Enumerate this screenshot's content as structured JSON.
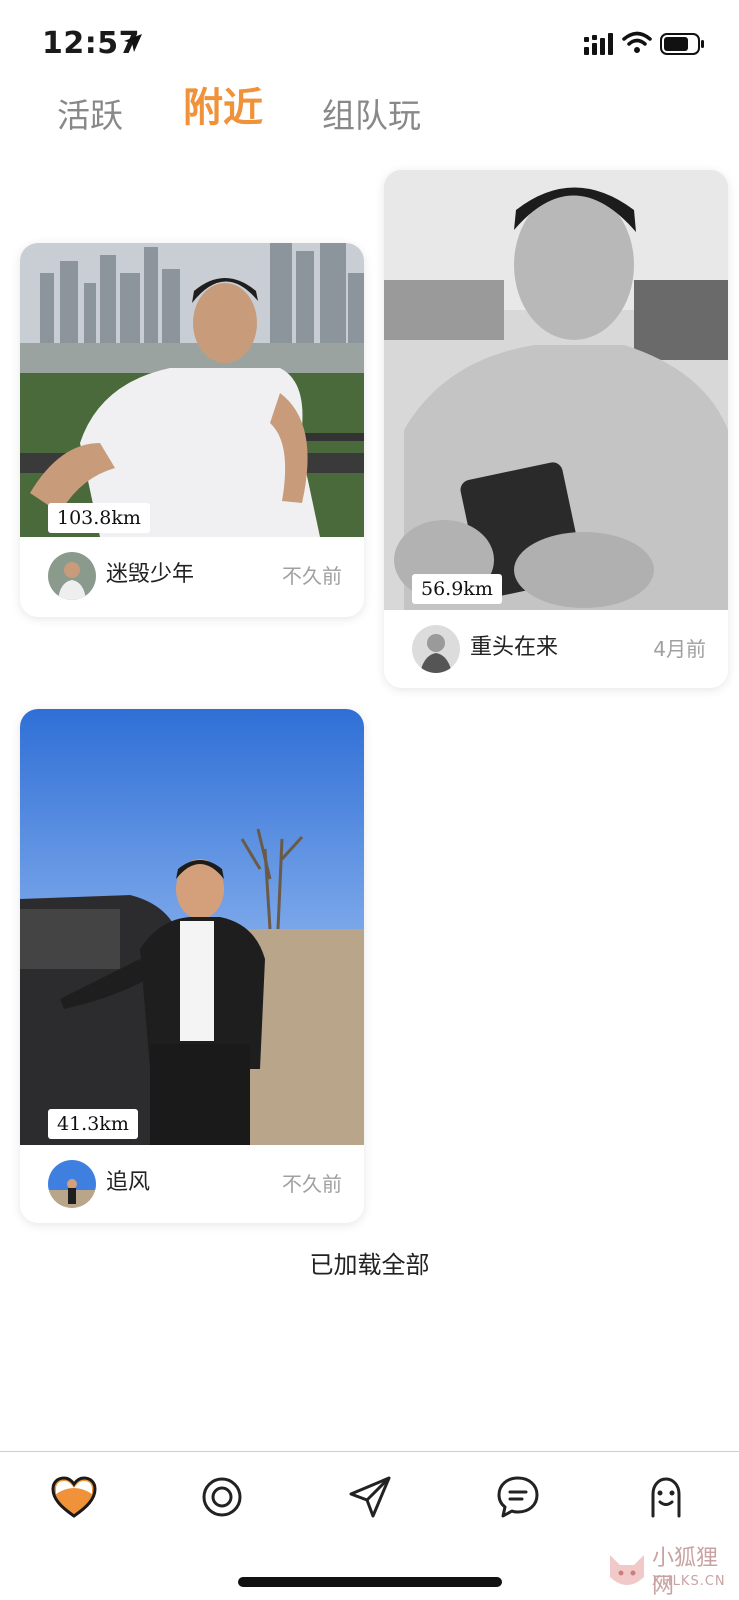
{
  "status_bar": {
    "time": "12:57"
  },
  "tabs": [
    {
      "label": "活跃",
      "active": false
    },
    {
      "label": "附近",
      "active": true
    },
    {
      "label": "组队玩",
      "active": false
    }
  ],
  "accent_color": "#f0923a",
  "cards": [
    {
      "distance": "103.8km",
      "name": "迷毁少年",
      "time": "不久前"
    },
    {
      "distance": "56.9km",
      "name": "重头在来",
      "time": "4月前"
    },
    {
      "distance": "41.3km",
      "name": "追风",
      "time": "不久前"
    }
  ],
  "footer_text": "已加载全部",
  "bottom_nav": [
    {
      "icon": "heart-icon",
      "active": true
    },
    {
      "icon": "target-icon",
      "active": false
    },
    {
      "icon": "send-icon",
      "active": false
    },
    {
      "icon": "chat-icon",
      "active": false
    },
    {
      "icon": "profile-icon",
      "active": false
    }
  ],
  "watermark": {
    "text": "小狐狸网",
    "sub": "XHLKS.CN"
  }
}
